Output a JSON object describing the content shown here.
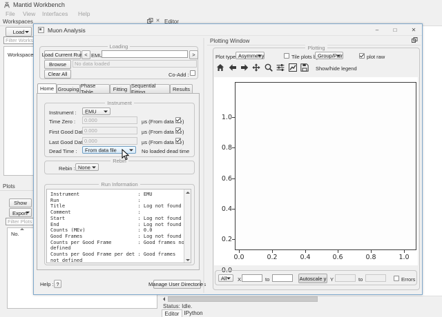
{
  "app": {
    "title": "Mantid Workbench",
    "menu": [
      "File",
      "View",
      "Interfaces",
      "Help"
    ],
    "status": "Status: Idle.",
    "bottom_tabs": [
      "Editor",
      "IPython"
    ]
  },
  "workspaces": {
    "dock_title": "Workspaces",
    "load_button": "Load",
    "filter_placeholder": "Filter Workspaces",
    "tree_items": [
      "Workspaces"
    ]
  },
  "plots": {
    "dock_title": "Plots",
    "show_button": "Show",
    "export_button": "Export",
    "filter_placeholder": "Filter Plots",
    "column_header": "No."
  },
  "editor": {
    "dock_title": "Editor"
  },
  "muon": {
    "title": "Muon Analysis",
    "window_controls": {
      "minimize": "–",
      "maximize": "□",
      "close": "✕"
    },
    "loading": {
      "title": "Loading",
      "load_current_run": "Load Current Run",
      "prev_run": "<",
      "next_run": ">",
      "instrument": "EMU",
      "run_value": "",
      "browse": "Browse",
      "load_status": "No data loaded",
      "clear_all": "Clear All",
      "coadd_label": "Co-Add :"
    },
    "tabs": [
      "Home",
      "Grouping",
      "Phase Table",
      "Fitting",
      "Sequential Fitting",
      "Results"
    ],
    "active_tab": "Home",
    "instrument_group": {
      "title": "Instrument",
      "instrument_label": "Instrument :",
      "instrument_value": "EMU",
      "rows": [
        {
          "label": "Time Zero :",
          "value": "0.000",
          "unit": "µs (From data file",
          "unit_end": ")"
        },
        {
          "label": "First Good Data :",
          "value": "0.000",
          "unit": "µs (From data file",
          "unit_end": ")"
        },
        {
          "label": "Last Good Data :",
          "value": "0.000",
          "unit": "µs (From data file",
          "unit_end": ")"
        }
      ],
      "dead_time_label": "Dead Time :",
      "dead_time_value": "From data file",
      "dead_time_status": "No loaded dead time"
    },
    "rebin_group": {
      "title": "Rebin",
      "label": "Rebin :",
      "value": "None"
    },
    "run_information": {
      "title": "Run Information",
      "lines": [
        "Instrument                    : EMU",
        "Run                           :",
        "Title                         : Log not found",
        "Comment                       :",
        "Start                         : Log not found",
        "End                           : Log not found",
        "Counts (MEv)                  : 0.0",
        "Good Frames                   : Log not found",
        "Counts per Good Frame         : Good frames not",
        "defined",
        "Counts per Good Frame per det : Good frames",
        "not defined"
      ]
    },
    "help_label": "Help :",
    "help_button": "?",
    "manage_directories": "Manage User Directories"
  },
  "plotting": {
    "dock_title": "Plotting Window",
    "group_title": "Plotting",
    "plot_type_label": "Plot type :",
    "plot_type_value": "Asymmetry",
    "tile_label": "Tile plots by:",
    "tile_checked": false,
    "tile_value": "Group/Pair",
    "plot_raw_label": "plot raw",
    "plot_raw_checked": true,
    "legend_label": "Show/hide legend",
    "toolbar_icons": [
      "home-icon",
      "back-arrow-icon",
      "forward-arrow-icon",
      "pan-move-icon",
      "zoom-magnifier-icon",
      "configure-subplots-icon",
      "edit-curves-icon",
      "save-figure-icon"
    ],
    "quick_edit": {
      "selector_value": "All",
      "x_label": "X",
      "x_min": "",
      "to_label": "to",
      "x_max": "",
      "autoscale_button": "Autoscale y",
      "y_label": "Y",
      "y_min": "",
      "y_max": "",
      "errors_label": "Errors",
      "errors_checked": false
    }
  },
  "chart_data": {
    "type": "line",
    "title": "",
    "xlabel": "",
    "ylabel": "",
    "series": [],
    "xlim": [
      0.0,
      1.0
    ],
    "ylim": [
      0.0,
      1.0
    ],
    "xticks": [
      "0.0",
      "0.2",
      "0.4",
      "0.6",
      "0.8",
      "1.0"
    ],
    "yticks": [
      "0.0",
      "0.2",
      "0.4",
      "0.6",
      "0.8",
      "1.0"
    ],
    "grid": false,
    "legend": false
  }
}
